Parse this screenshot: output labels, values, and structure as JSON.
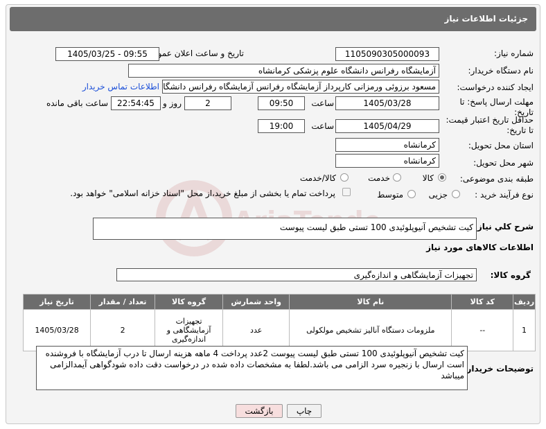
{
  "header": {
    "title": "جزئیات اطلاعات نیاز"
  },
  "fields": {
    "need_number_label": "شماره نیاز:",
    "need_number": "1105090305000093",
    "announce_label": "تاریخ و ساعت اعلان عمومی:",
    "announce_value": "1405/03/25 - 09:55",
    "buyer_org_label": "نام دستگاه خریدار:",
    "buyer_org": "آزمایشگاه رفرانس دانشگاه علوم پزشکی کرمانشاه",
    "creator_label": "ایجاد کننده درخواست:",
    "creator": "مسعود برزوئی ورمزانی کارپرداز آزمایشگاه رفرانس آزمایشگاه رفرانس دانشگاه ع",
    "contact_link": "اطلاعات تماس خریدار",
    "deadline_label_1": "مهلت ارسال پاسخ: تا",
    "deadline_label_2": "تاریخ:",
    "deadline_date": "1405/03/28",
    "time_label": "ساعت",
    "deadline_time": "09:50",
    "days_value": "2",
    "days_label": "روز و",
    "remaining_time": "22:54:45",
    "remaining_label": "ساعت باقی مانده",
    "validity_label_1": "حداقل تاریخ اعتبار قیمت:",
    "validity_label_2": "تا تاریخ:",
    "validity_date": "1405/04/29",
    "validity_time_label": "ساعت",
    "validity_time": "19:00",
    "province_label": "استان محل تحویل:",
    "province": "کرمانشاه",
    "city_label": "شهر محل تحویل:",
    "city": "کرمانشاه",
    "category_label": "طبقه بندی موضوعی:",
    "category_options": [
      "کالا",
      "خدمت",
      "کالا/خدمت"
    ],
    "process_label": "نوع فرآیند خرید :",
    "process_options": [
      "جزیی",
      "متوسط"
    ],
    "payment_note": "پرداخت تمام یا بخشی از مبلغ خرید،از محل \"اسناد خزانه اسلامی\" خواهد بود.",
    "summary_label": "شرح کلي نياز:",
    "summary": "کیت تشخیص آنیوپلوئیدی 100 تستی  طبق لیست پیوست",
    "goods_info_label": "اطلاعات کالاهای مورد نیاز",
    "goods_group_label": "گروه کالا:",
    "goods_group": "تجهیزات آزمایشگاهی و اندازه‌گیری"
  },
  "table": {
    "headers": [
      "ردیف",
      "کد کالا",
      "نام کالا",
      "واحد شمارش",
      "گروه کالا",
      "تعداد / مقدار",
      "تاریخ نیاز"
    ],
    "rows": [
      [
        "1",
        "--",
        "ملزومات دستگاه آنالیز تشخیص مولکولی",
        "عدد",
        "تجهیزات آزمایشگاهی و اندازه‌گیری",
        "2",
        "1405/03/28"
      ]
    ]
  },
  "buyer_notes_label": "توضیحات خریدار:",
  "buyer_notes": "کیت تشخیص آنیوپلوئیدی 100 تستی  طبق لیست پیوست  2عدد پرداخت 4 ماهه هزینه ارسال تا درب آزمایشگاه با فروشنده است ارسال با زنجیره سرد الزامی می باشد.لطفا به مشخصات داده شده در درخواست دقت داده شودگواهی آیمدالزامی میباشد",
  "buttons": {
    "print": "چاپ",
    "back": "بازگشت"
  },
  "watermark_text": "AriaTender.neT",
  "colors": {
    "header_bg": "#6d6d6d",
    "link": "#1a4ed8",
    "back_button_bg": "#f7dede"
  }
}
